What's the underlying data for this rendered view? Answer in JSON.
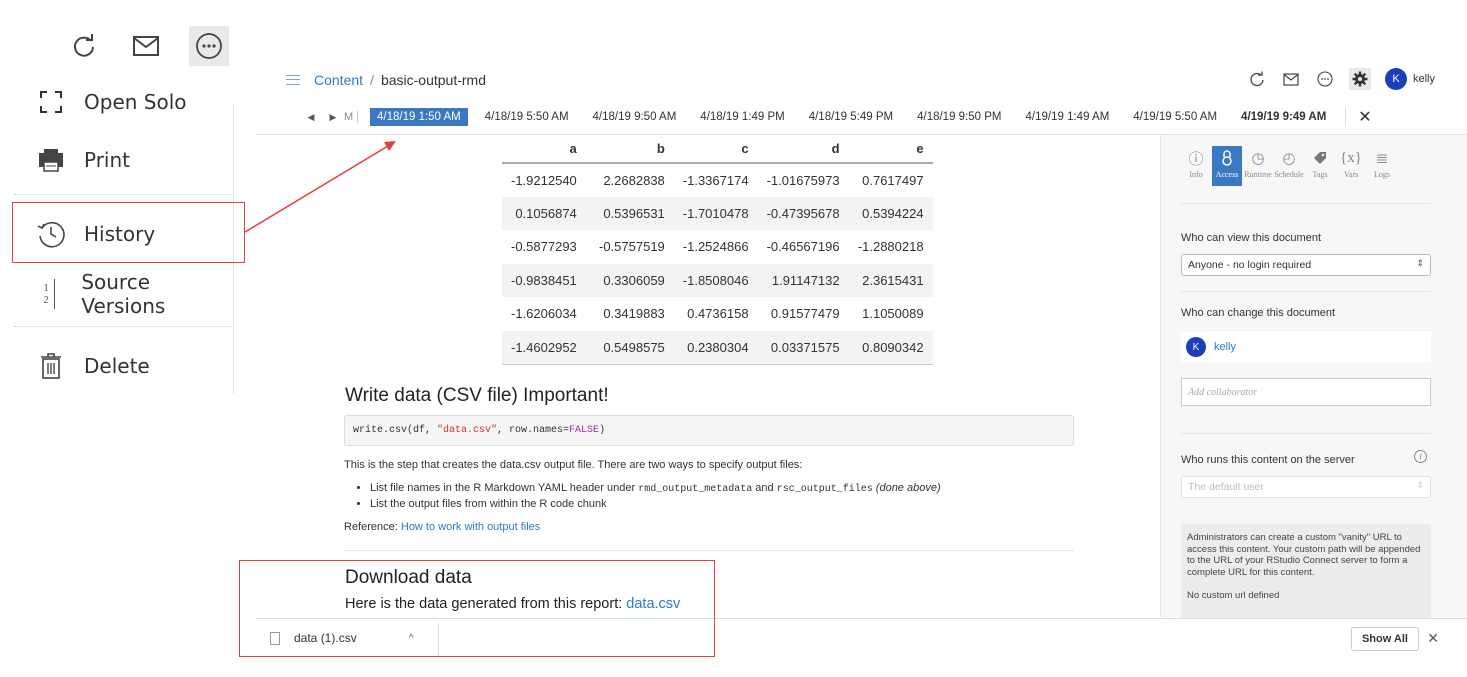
{
  "menu": {
    "items": [
      {
        "label": "Open Solo",
        "icon": "expand-icon"
      },
      {
        "label": "Print",
        "icon": "printer-icon"
      },
      {
        "label": "History",
        "icon": "history-icon"
      },
      {
        "label": "Source Versions",
        "icon": "source-versions-icon"
      },
      {
        "label": "Delete",
        "icon": "trash-icon"
      }
    ],
    "source_versions_glyph_top": "1",
    "source_versions_glyph_bottom": "2"
  },
  "header": {
    "breadcrumb_root": "Content",
    "breadcrumb_sep": "/",
    "breadcrumb_current": "basic-output-rmd",
    "user": {
      "initial": "K",
      "name": "kelly"
    }
  },
  "timeline": {
    "prev": "◀",
    "next": "▶",
    "month_marker": "M",
    "entries": [
      "4/18/19 1:50 AM",
      "4/18/19 5:50 AM",
      "4/18/19 9:50 AM",
      "4/18/19 1:49 PM",
      "4/18/19 5:49 PM",
      "4/18/19 9:50 PM",
      "4/19/19 1:49 AM",
      "4/19/19 5:50 AM",
      "4/19/19 9:49 AM"
    ],
    "active_index": 0,
    "current_index": 8,
    "close": "✕"
  },
  "table": {
    "columns": [
      "a",
      "b",
      "c",
      "d",
      "e"
    ],
    "rows": [
      [
        "-1.9212540",
        "2.2682838",
        "-1.3367174",
        "-1.01675973",
        "0.7617497"
      ],
      [
        "0.1056874",
        "0.5396531",
        "-1.7010478",
        "-0.47395678",
        "0.5394224"
      ],
      [
        "-0.5877293",
        "-0.5757519",
        "-1.2524866",
        "-0.46567196",
        "-1.2880218"
      ],
      [
        "-0.9838451",
        "0.3306059",
        "-1.8508046",
        "1.91147132",
        "2.3615431"
      ],
      [
        "-1.6206034",
        "0.3419883",
        "0.4736158",
        "0.91577479",
        "1.1050089"
      ],
      [
        "-1.4602952",
        "0.5498575",
        "0.2380304",
        "0.03371575",
        "0.8090342"
      ]
    ]
  },
  "doc": {
    "write_heading": "Write data (CSV file) Important!",
    "code_pre": "write.csv(df, ",
    "code_str": "\"data.csv\"",
    "code_mid": ", row.names=",
    "code_kw": "FALSE",
    "code_post": ")",
    "para1": "This is the step that creates the data.csv output file. There are two ways to specify output files:",
    "bullet1_pre": "List file names in the R Markdown YAML header under ",
    "bullet1_code1": "rmd_output_metadata",
    "bullet1_and": " and ",
    "bullet1_code2": "rsc_output_files",
    "bullet1_em": " (done above)",
    "bullet2": "List the output files from within the R code chunk",
    "ref_label": "Reference: ",
    "ref_link": "How to work with output files",
    "download_heading": "Download data",
    "download_text": "Here is the data generated from this report: ",
    "download_link": "data.csv"
  },
  "panel": {
    "tabs": [
      {
        "label": "Info",
        "icon": "info-icon",
        "glyph": "ⓘ"
      },
      {
        "label": "Access",
        "icon": "lock-icon",
        "glyph": "🔒"
      },
      {
        "label": "Runtime",
        "icon": "runtime-icon",
        "glyph": "◷"
      },
      {
        "label": "Schedule",
        "icon": "clock-icon",
        "glyph": "◴"
      },
      {
        "label": "Tags",
        "icon": "tag-icon",
        "glyph": "🏷"
      },
      {
        "label": "Vars",
        "icon": "vars-icon",
        "glyph": "{x}"
      },
      {
        "label": "Logs",
        "icon": "logs-icon",
        "glyph": "≣"
      }
    ],
    "active_tab": "Access",
    "view_label": "Who can view this document",
    "view_value": "Anyone - no login required",
    "change_label": "Who can change this document",
    "collaborator_initial": "K",
    "collaborator_name": "kelly",
    "add_collaborator_placeholder": "Add collaborator",
    "runs_label": "Who runs this content on the server",
    "runs_value": "The default user",
    "vanity_text": "Administrators can create a custom \"vanity\" URL to access this content. Your custom path will be appended to the URL of your RStudio Connect server to form a complete URL for this content.",
    "vanity_none": "No custom url defined"
  },
  "downloads": {
    "file_name": "data (1).csv",
    "caret": "^",
    "show_all": "Show All",
    "close": "✕"
  },
  "colors": {
    "accent": "#3b78c4",
    "link": "#2f79c6",
    "annotation": "#e04040",
    "avatar": "#1a3fb8"
  }
}
